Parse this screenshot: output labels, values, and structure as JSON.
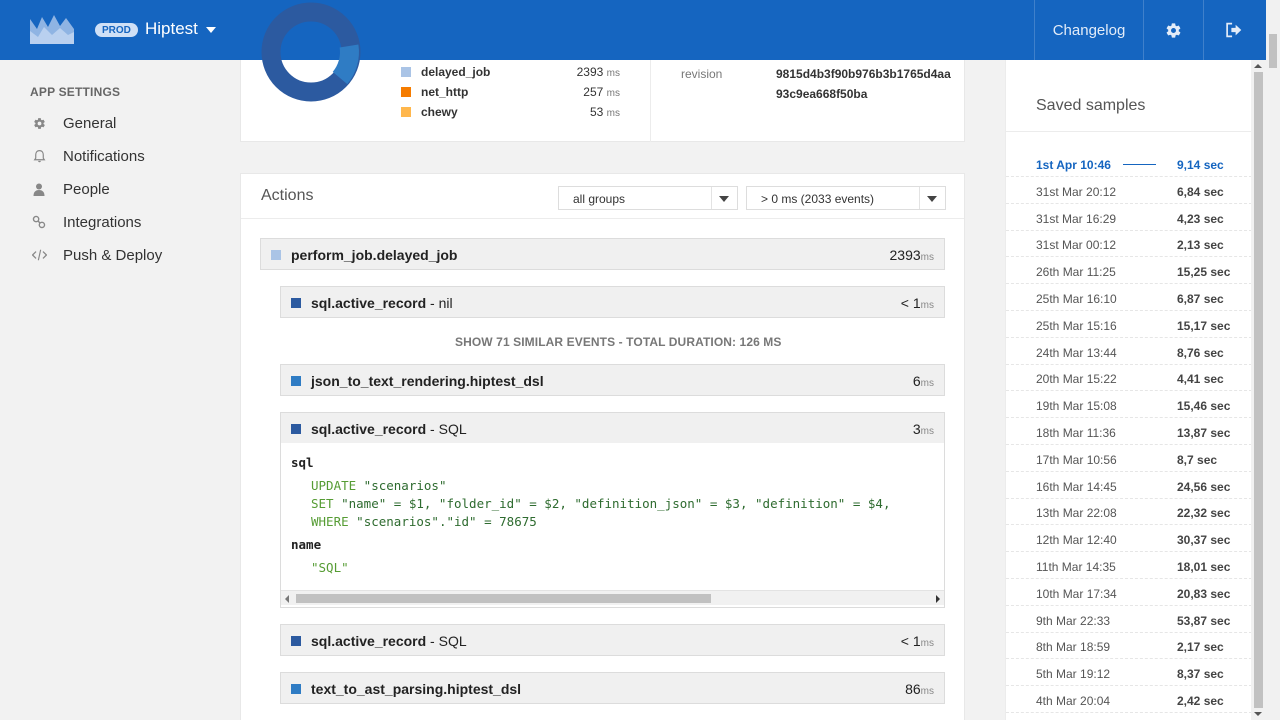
{
  "header": {
    "env_badge": "PROD",
    "app_name": "Hiptest",
    "changelog_label": "Changelog",
    "logo_icon": "mountain-logo-icon",
    "gear_icon": "gear-icon",
    "logout_icon": "logout-icon"
  },
  "sidebar": {
    "title": "APP SETTINGS",
    "items": [
      {
        "label": "General",
        "icon": "gear-icon"
      },
      {
        "label": "Notifications",
        "icon": "bell-icon"
      },
      {
        "label": "People",
        "icon": "user-icon"
      },
      {
        "label": "Integrations",
        "icon": "link-icon"
      },
      {
        "label": "Push & Deploy",
        "icon": "code-icon"
      }
    ]
  },
  "summary": {
    "legend": [
      {
        "name": "delayed_job",
        "value": "2393",
        "unit": "ms",
        "color": "#aac4e6"
      },
      {
        "name": "net_http",
        "value": "257",
        "unit": "ms",
        "color": "#f57c00"
      },
      {
        "name": "chewy",
        "value": "53",
        "unit": "ms",
        "color": "#ffb74d"
      }
    ],
    "revision_label": "revision",
    "revision_value": "9815d4b3f90b976b3b1765d4aa93c9ea668f50ba",
    "donut_colors": {
      "main": "#2c5aa0",
      "accent": "#2f7cc4"
    }
  },
  "actions": {
    "title": "Actions",
    "group_select": "all groups",
    "duration_select": "> 0 ms (2033 events)",
    "root_event": {
      "name": "perform_job.delayed_job",
      "value": "2393",
      "unit": "ms",
      "color": "#aac4e6"
    },
    "events": [
      {
        "name": "sql.active_record",
        "suffix": " - nil",
        "value": "< 1",
        "unit": "ms",
        "color": "#2c5aa0"
      },
      {
        "name": "json_to_text_rendering.hiptest_dsl",
        "suffix": "",
        "value": "6",
        "unit": "ms",
        "color": "#2f7cc4"
      },
      {
        "name": "sql.active_record",
        "suffix": " - SQL",
        "value": "3",
        "unit": "ms",
        "color": "#2c5aa0"
      },
      {
        "name": "sql.active_record",
        "suffix": " - SQL",
        "value": "< 1",
        "unit": "ms",
        "color": "#2c5aa0"
      },
      {
        "name": "text_to_ast_parsing.hiptest_dsl",
        "suffix": "",
        "value": "86",
        "unit": "ms",
        "color": "#2f7cc4"
      }
    ],
    "similar_text": "SHOW 71 SIMILAR EVENTS   -  TOTAL DURATION: 126 MS",
    "detail": {
      "key1": "sql",
      "line1_kw": "UPDATE",
      "line1_rest": " \"scenarios\"",
      "line2_kw": "SET",
      "line2_rest": " \"name\" = $1, \"folder_id\" = $2, \"definition_json\" = $3, \"definition\" = $4,",
      "line3_kw": "WHERE",
      "line3_rest": " \"scenarios\".\"id\" = 78675",
      "key2": "name",
      "name_value": "\"SQL\""
    }
  },
  "samples": {
    "title": "Saved samples",
    "rows": [
      {
        "date": "1st Apr 10:46",
        "value": "9,14 sec",
        "active": true
      },
      {
        "date": "31st Mar 20:12",
        "value": "6,84 sec"
      },
      {
        "date": "31st Mar 16:29",
        "value": "4,23 sec"
      },
      {
        "date": "31st Mar 00:12",
        "value": "2,13 sec"
      },
      {
        "date": "26th Mar 11:25",
        "value": "15,25 sec"
      },
      {
        "date": "25th Mar 16:10",
        "value": "6,87 sec"
      },
      {
        "date": "25th Mar 15:16",
        "value": "15,17 sec"
      },
      {
        "date": "24th Mar 13:44",
        "value": "8,76 sec"
      },
      {
        "date": "20th Mar 15:22",
        "value": "4,41 sec"
      },
      {
        "date": "19th Mar 15:08",
        "value": "15,46 sec"
      },
      {
        "date": "18th Mar 11:36",
        "value": "13,87 sec"
      },
      {
        "date": "17th Mar 10:56",
        "value": "8,7 sec"
      },
      {
        "date": "16th Mar 14:45",
        "value": "24,56 sec"
      },
      {
        "date": "13th Mar 22:08",
        "value": "22,32 sec"
      },
      {
        "date": "12th Mar 12:40",
        "value": "30,37 sec"
      },
      {
        "date": "11th Mar 14:35",
        "value": "18,01 sec"
      },
      {
        "date": "10th Mar 17:34",
        "value": "20,83 sec"
      },
      {
        "date": "9th Mar 22:33",
        "value": "53,87 sec"
      },
      {
        "date": "8th Mar 18:59",
        "value": "2,17 sec"
      },
      {
        "date": "5th Mar 19:12",
        "value": "8,37 sec"
      },
      {
        "date": "4th Mar 20:04",
        "value": "2,42 sec"
      }
    ]
  }
}
